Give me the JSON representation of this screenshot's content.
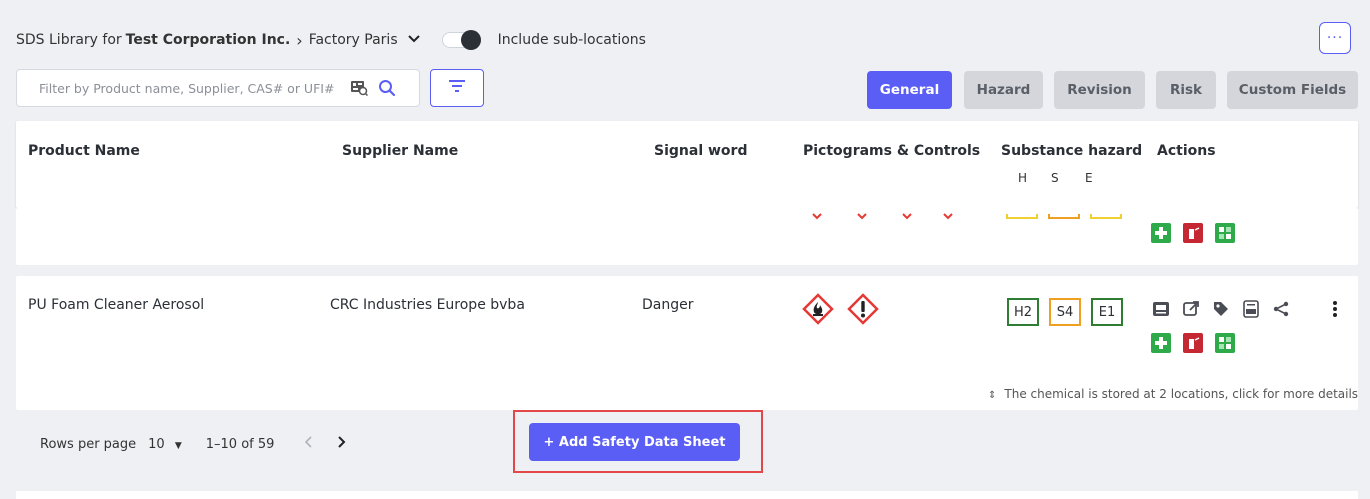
{
  "breadcrumb": {
    "prefix": "SDS Library for",
    "company": "Test Corporation Inc.",
    "separator": "›",
    "location": "Factory Paris"
  },
  "include_sub_locations": {
    "label": "Include sub-locations",
    "enabled": true
  },
  "more_button": {
    "label": "···"
  },
  "search": {
    "placeholder": "Filter by Product name, Supplier, CAS# or UFI#"
  },
  "tabs": [
    {
      "label": "General",
      "active": true
    },
    {
      "label": "Hazard",
      "active": false
    },
    {
      "label": "Revision",
      "active": false
    },
    {
      "label": "Risk",
      "active": false
    },
    {
      "label": "Custom Fields",
      "active": false
    }
  ],
  "table": {
    "columns": {
      "product": "Product Name",
      "supplier": "Supplier Name",
      "signal": "Signal word",
      "pictograms": "Pictograms & Controls",
      "substance": "Substance hazard",
      "actions": "Actions"
    },
    "substance_sub": [
      "H",
      "S",
      "E"
    ],
    "rows": [
      {
        "product": "PU Foam Cleaner Aerosol",
        "supplier": "CRC Industries Europe bvba",
        "signal": "Danger",
        "pictograms": [
          "flammable-pictogram",
          "exclamation-pictogram"
        ],
        "hazards": [
          {
            "label": "H2",
            "color": "#2e7d32"
          },
          {
            "label": "S4",
            "color": "#f0a020"
          },
          {
            "label": "E1",
            "color": "#2e7d32"
          }
        ],
        "stored_note": "The chemical is stored at 2 locations, click for more details"
      }
    ]
  },
  "pagination": {
    "rows_per_page_label": "Rows per page",
    "rows_per_page_value": "10",
    "range": "1–10 of 59"
  },
  "add_button": {
    "label": "+  Add Safety Data Sheet"
  },
  "colors": {
    "accent": "#5b5ef4",
    "highlight": "#e4474a",
    "danger_red": "#e53935",
    "first_aid_green": "#2eaa4a",
    "fire_red": "#c62833"
  }
}
